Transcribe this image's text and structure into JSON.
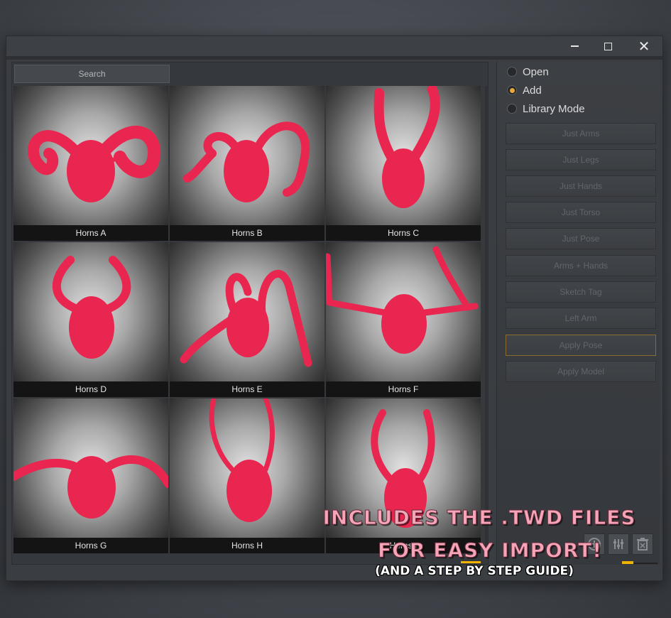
{
  "window": {
    "controls": {
      "minimize": "minimize",
      "maximize": "maximize",
      "close": "✕"
    }
  },
  "search": {
    "placeholder": "Search"
  },
  "thumbnails": [
    {
      "label": "Horns A"
    },
    {
      "label": "Horns B"
    },
    {
      "label": "Horns C"
    },
    {
      "label": "Horns D"
    },
    {
      "label": "Horns E"
    },
    {
      "label": "Horns F"
    },
    {
      "label": "Horns G"
    },
    {
      "label": "Horns H"
    },
    {
      "label": "Horns I"
    }
  ],
  "mode_options": [
    {
      "label": "Open",
      "selected": false
    },
    {
      "label": "Add",
      "selected": true
    },
    {
      "label": "Library Mode",
      "selected": false
    }
  ],
  "buttons": [
    {
      "label": "Just Arms"
    },
    {
      "label": "Just Legs"
    },
    {
      "label": "Just Hands"
    },
    {
      "label": "Just Torso"
    },
    {
      "label": "Just Pose"
    },
    {
      "label": "Arms + Hands"
    },
    {
      "label": "Sketch Tag"
    },
    {
      "label": "Left Arm"
    },
    {
      "label": "Apply Pose"
    },
    {
      "label": "Apply Model"
    }
  ],
  "toolbar_icons": [
    "add-icon",
    "sliders-icon",
    "trash-icon"
  ],
  "promo": {
    "line1": "INCLUDES THE .TWD FILES",
    "line2": "FOR EASY IMPORT!",
    "line3": "(AND A STEP BY STEP GUIDE)"
  },
  "colors": {
    "accent": "#f0b400",
    "horn_red": "#e8264f",
    "promo_pink": "#f4a6b8"
  }
}
